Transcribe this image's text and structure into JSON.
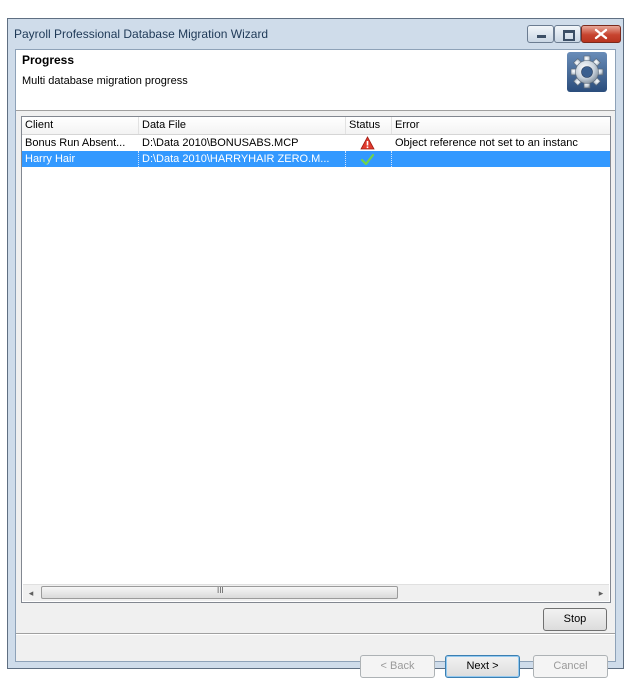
{
  "window": {
    "title": "Payroll Professional Database Migration Wizard",
    "controls": [
      "minimize-icon",
      "maximize-icon",
      "close-icon"
    ]
  },
  "header": {
    "title": "Progress",
    "subtitle": "Multi database migration progress",
    "icon": "gear-icon"
  },
  "table": {
    "columns": [
      "Client",
      "Data File",
      "Status",
      "Error"
    ],
    "rows": [
      {
        "client": "Bonus Run Absent...",
        "data_file": "D:\\Data 2010\\BONUSABS.MCP",
        "status_icon": "warning-icon",
        "error": "Object reference not set to an instanc",
        "selected": false
      },
      {
        "client": "Harry Hair",
        "data_file": "D:\\Data 2010\\HARRYHAIR ZERO.M...",
        "status_icon": "checkmark-icon",
        "error": "",
        "selected": true
      }
    ],
    "scroll_left_glyph": "◂",
    "scroll_right_glyph": "▸",
    "scroll_thumb_grip": "III"
  },
  "buttons": {
    "stop": "Stop",
    "back": "< Back",
    "next": "Next >",
    "cancel": "Cancel"
  },
  "colors": {
    "selection": "#3399ff",
    "warning": "#e23b2e",
    "success": "#4caf2a"
  }
}
